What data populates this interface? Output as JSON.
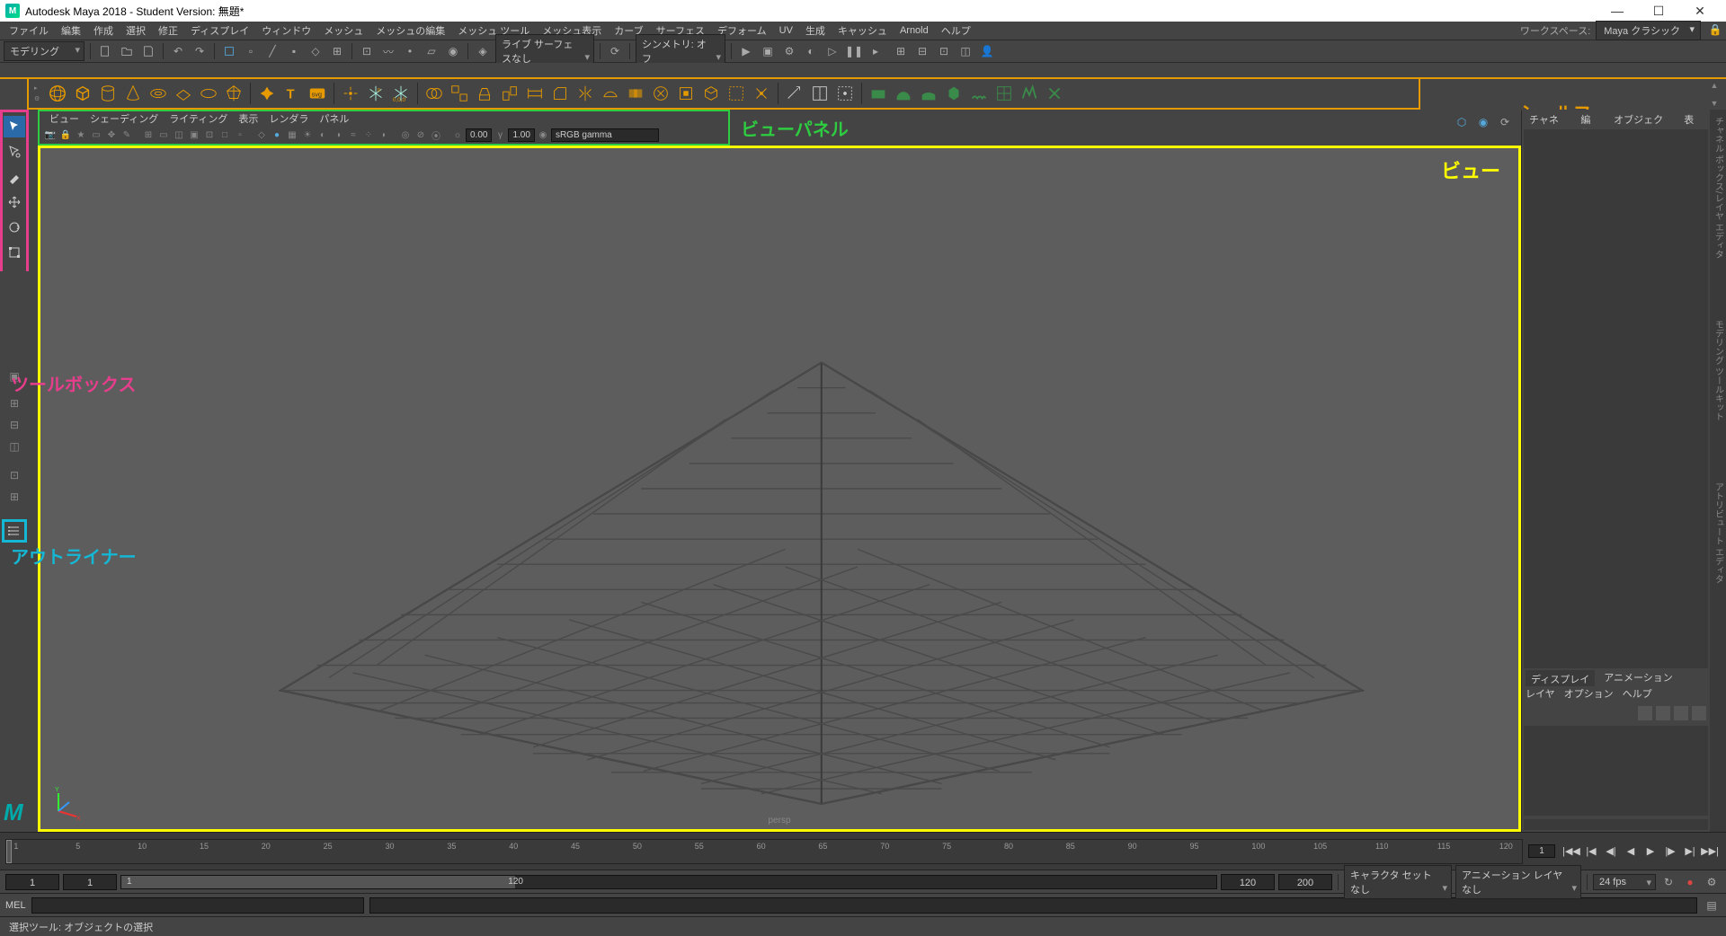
{
  "window": {
    "title": "Autodesk Maya 2018 - Student Version: 無題*"
  },
  "menubar": {
    "items": [
      "ファイル",
      "編集",
      "作成",
      "選択",
      "修正",
      "ディスプレイ",
      "ウィンドウ",
      "メッシュ",
      "メッシュの編集",
      "メッシュ ツール",
      "メッシュ表示",
      "カーブ",
      "サーフェス",
      "デフォーム",
      "UV",
      "生成",
      "キャッシュ",
      "Arnold",
      "ヘルプ"
    ],
    "workspace_label": "ワークスペース:",
    "workspace_value": "Maya クラシック"
  },
  "statusline": {
    "mode": "モデリング",
    "live_surface": "ライブ サーフェスなし",
    "symmetry": "シンメトリ: オフ"
  },
  "annotations": {
    "shelf": "シェルフ",
    "toolbox": "ツールボックス",
    "outliner": "アウトライナー",
    "viewpanel": "ビューパネル",
    "view": "ビュー"
  },
  "viewpanel": {
    "menus": [
      "ビュー",
      "シェーディング",
      "ライティング",
      "表示",
      "レンダラ",
      "パネル"
    ],
    "near": "0.00",
    "far": "1.00",
    "colorspace": "sRGB gamma"
  },
  "channelbox": {
    "tabs": [
      "チャネル",
      "編集",
      "オブジェクト",
      "表示"
    ],
    "display_tabs": {
      "display": "ディスプレイ",
      "anim": "アニメーション"
    },
    "layer_menus": [
      "レイヤ",
      "オプション",
      "ヘルプ"
    ]
  },
  "vertical_tabs": [
    "チャネル ボックス/レイヤ エディタ",
    "モデリング ツールキット",
    "アトリビュート エディタ"
  ],
  "timeline": {
    "ticks": [
      1,
      5,
      10,
      15,
      20,
      25,
      30,
      35,
      40,
      45,
      50,
      55,
      60,
      65,
      70,
      75,
      80,
      85,
      90,
      95,
      100,
      105,
      110,
      115,
      120
    ],
    "cur_label": "1"
  },
  "range": {
    "start_out": "1",
    "start_in": "1",
    "slider_label": "1",
    "slider_end": "120",
    "end_in": "120",
    "end_out": "200",
    "charset": "キャラクタ セットなし",
    "animlayer": "アニメーション レイヤなし",
    "fps": "24 fps"
  },
  "cmd": {
    "label": "MEL"
  },
  "help": {
    "text": "選択ツール: オブジェクトの選択"
  }
}
